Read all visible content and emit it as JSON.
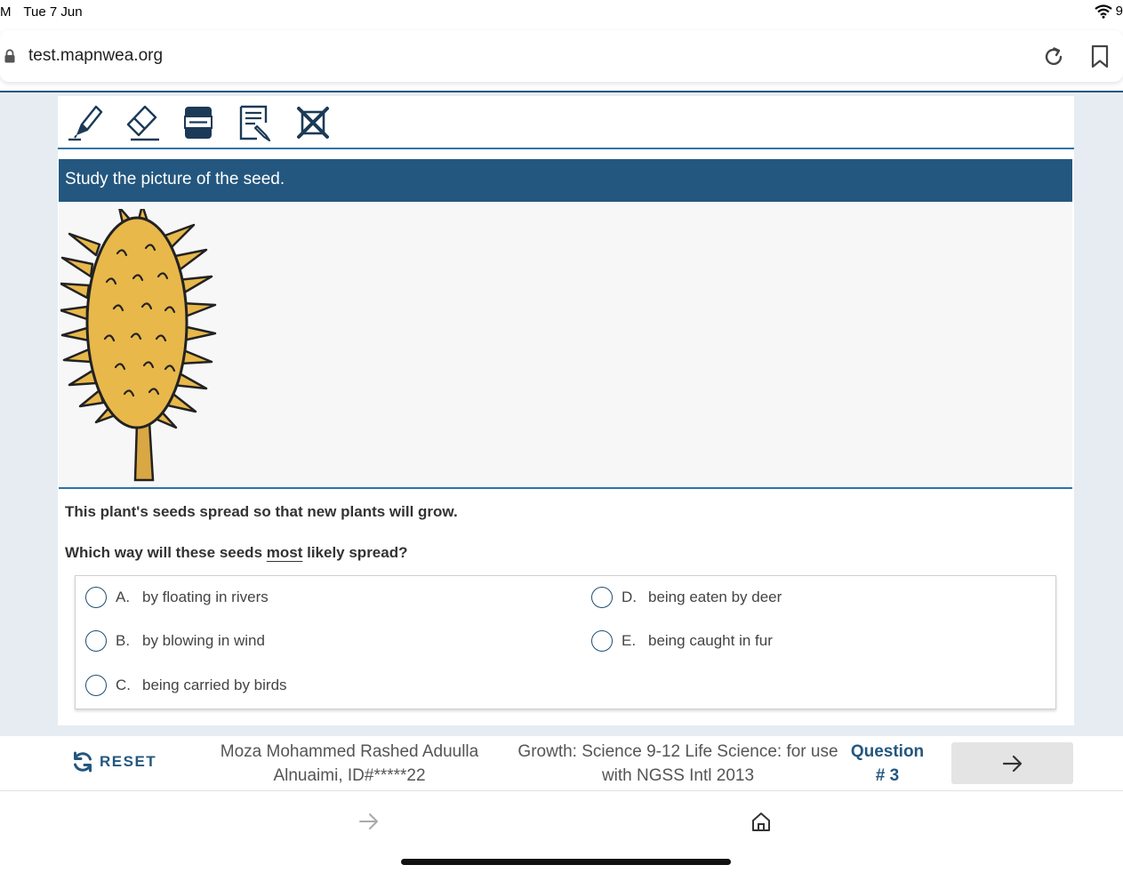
{
  "status_bar": {
    "time": "M",
    "date": "Tue 7 Jun",
    "battery": "9"
  },
  "browser": {
    "url": "test.mapnwea.org"
  },
  "toolbar": {
    "tools": [
      "highlighter-icon",
      "eraser-icon",
      "line-reader-icon",
      "notepad-icon",
      "answer-eliminator-icon"
    ]
  },
  "stimulus": {
    "header": "Study the picture of the seed."
  },
  "question": {
    "line1": "This plant's seeds spread so that new plants will grow.",
    "line2_before": "Which way will these seeds ",
    "line2_emphasis": "most",
    "line2_after": " likely spread?",
    "choices": [
      {
        "letter": "A.",
        "text": "by floating in rivers"
      },
      {
        "letter": "B.",
        "text": "by blowing in wind"
      },
      {
        "letter": "C.",
        "text": "being carried by birds"
      },
      {
        "letter": "D.",
        "text": "being eaten by deer"
      },
      {
        "letter": "E.",
        "text": "being caught in fur"
      }
    ]
  },
  "footer": {
    "reset_label": "RESET",
    "student_line1": "Moza Mohammed Rashed Aduulla",
    "student_line2": "Alnuaimi, ID#*****22",
    "test_line1": "Growth: Science 9-12 Life Science: for use",
    "test_line2": "with NGSS Intl 2013",
    "question_line1": "Question",
    "question_line2": "# 3"
  },
  "colors": {
    "primary": "#24577f",
    "accent_line": "#2f73a6",
    "seed": "#e8b84b",
    "background": "#e6ecf2"
  }
}
